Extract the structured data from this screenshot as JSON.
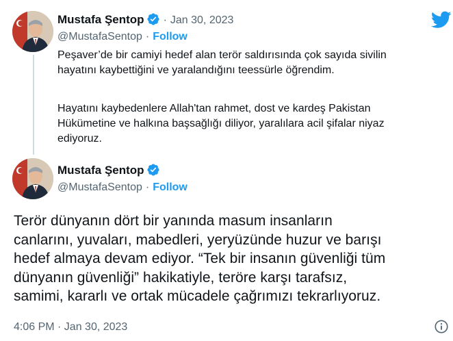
{
  "reply_tweet": {
    "author_name": "Mustafa Şentop",
    "handle": "@MustafaSentop",
    "separator": "·",
    "date": "Jan 30, 2023",
    "follow_label": "Follow",
    "paragraph_1": "Peşaver’de bir camiyi hedef alan terör saldırısında çok sayıda sivilin\nhayatını kaybettiğini ve yaralandığını teessürle öğrendim.",
    "paragraph_2": "Hayatını kaybedenlere Allah'tan rahmet, dost ve kardeş Pakistan\nHükümetine ve halkına başsağlığı diliyor, yaralılara acil şifalar niyaz\nediyoruz."
  },
  "main_tweet": {
    "author_name": "Mustafa Şentop",
    "handle": "@MustafaSentop",
    "separator": "·",
    "follow_label": "Follow",
    "text_lines": [
      "Terör dünyanın dört bir yanında masum insanların",
      "canlarını, yuvaları, mabedleri, yeryüzünde huzur ve barışı",
      "hedef almaya devam ediyor. “Tek bir insanın güvenliği tüm",
      "dünyanın güvenliği” hakikatiyle, teröre karşı tarafsız,",
      "samimi, kararlı ve ortak mücadele çağrımızı tekrarlıyoruz."
    ],
    "timestamp": "4:06 PM · Jan 30, 2023"
  },
  "icons": {
    "brand": "twitter-bird-icon",
    "verified": "verified-badge-icon",
    "info": "info-icon"
  },
  "colors": {
    "accent": "#1d9bf0",
    "secondary_text": "#536471",
    "primary_text": "#0f1419",
    "thread_line": "#cfd9de"
  }
}
